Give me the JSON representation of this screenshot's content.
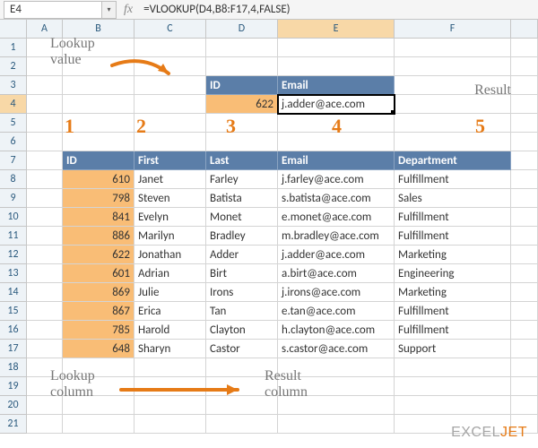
{
  "cellref": "E4",
  "formula": "=VLOOKUP(D4,B8:F17,4,FALSE)",
  "columns": [
    "A",
    "B",
    "C",
    "D",
    "E",
    "F"
  ],
  "lookup_header": {
    "id": "ID",
    "email": "Email"
  },
  "lookup_value": "622",
  "lookup_result": "j.adder@ace.com",
  "colnums": [
    "1",
    "2",
    "3",
    "4",
    "5"
  ],
  "table_headers": [
    "ID",
    "First",
    "Last",
    "Email",
    "Department"
  ],
  "rows": [
    {
      "id": "610",
      "first": "Janet",
      "last": "Farley",
      "email": "j.farley@ace.com",
      "dept": "Fulfillment"
    },
    {
      "id": "798",
      "first": "Steven",
      "last": "Batista",
      "email": "s.batista@ace.com",
      "dept": "Sales"
    },
    {
      "id": "841",
      "first": "Evelyn",
      "last": "Monet",
      "email": "e.monet@ace.com",
      "dept": "Fulfillment"
    },
    {
      "id": "886",
      "first": "Marilyn",
      "last": "Bradley",
      "email": "m.bradley@ace.com",
      "dept": "Fulfillment"
    },
    {
      "id": "622",
      "first": "Jonathan",
      "last": "Adder",
      "email": "j.adder@ace.com",
      "dept": "Marketing"
    },
    {
      "id": "601",
      "first": "Adrian",
      "last": "Birt",
      "email": "a.birt@ace.com",
      "dept": "Engineering"
    },
    {
      "id": "869",
      "first": "Julie",
      "last": "Irons",
      "email": "j.irons@ace.com",
      "dept": "Marketing"
    },
    {
      "id": "867",
      "first": "Erica",
      "last": "Tan",
      "email": "e.tan@ace.com",
      "dept": "Fulfillment"
    },
    {
      "id": "785",
      "first": "Harold",
      "last": "Clayton",
      "email": "h.clayton@ace.com",
      "dept": "Fulfillment"
    },
    {
      "id": "648",
      "first": "Sharyn",
      "last": "Castor",
      "email": "s.castor@ace.com",
      "dept": "Support"
    }
  ],
  "labels": {
    "lookup_value": "Lookup\nvalue",
    "result": "Result",
    "lookup_column": "Lookup\ncolumn",
    "result_column": "Result\ncolumn"
  },
  "logo_a": "EXCEL",
  "logo_b": "JET"
}
